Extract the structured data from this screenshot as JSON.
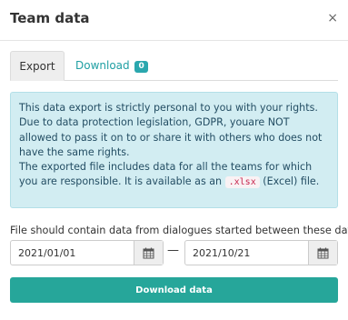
{
  "dialog": {
    "title": "Team data",
    "close_glyph": "×"
  },
  "tabs": [
    {
      "label": "Export",
      "active": true
    },
    {
      "label": "Download",
      "badge": "0",
      "active": false
    }
  ],
  "info": {
    "line1": "This data export is strictly personal to you with your rights. Due to data protection legislation, GDPR, youare NOT allowed to pass it on to or share it with others who does not have the same rights.",
    "line2_before": "The exported file includes data for all the teams for which you are responsible. It is available as an",
    "line2_code": ".xlsx",
    "line2_after": "(Excel) file."
  },
  "date_range": {
    "label": "File should contain data from dialogues started between these dates",
    "from": "2021/01/01",
    "to": "2021/10/21",
    "separator": "—"
  },
  "actions": {
    "download_label": "Download data"
  },
  "colors": {
    "accent": "#26a69a",
    "info_bg": "#d2edf2",
    "link": "#1f9fa3",
    "badge": "#2aa7ae"
  },
  "icons": {
    "close": "close-icon",
    "calendar": "calendar-icon"
  }
}
